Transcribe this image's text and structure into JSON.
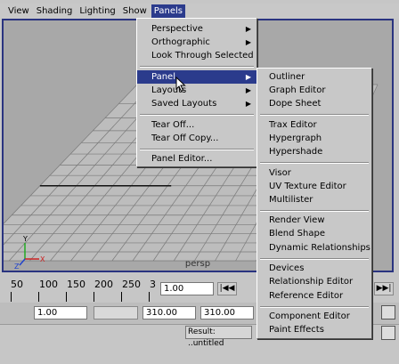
{
  "menubar": {
    "items": [
      {
        "label": "View"
      },
      {
        "label": "Shading"
      },
      {
        "label": "Lighting"
      },
      {
        "label": "Show"
      },
      {
        "label": "Panels"
      }
    ]
  },
  "viewport": {
    "camera_name": "persp",
    "axis": {
      "x": "X",
      "y": "Y",
      "z": "Z"
    }
  },
  "panels_menu": {
    "items": [
      "Perspective",
      "Orthographic",
      "Look Through Selected",
      "Panel",
      "Layouts",
      "Saved Layouts",
      "Tear Off...",
      "Tear Off Copy...",
      "Panel Editor..."
    ]
  },
  "panel_submenu": {
    "items": [
      "Outliner",
      "Graph Editor",
      "Dope Sheet",
      "Trax Editor",
      "Hypergraph",
      "Hypershade",
      "Visor",
      "UV Texture Editor",
      "Multilister",
      "Render View",
      "Blend Shape",
      "Dynamic Relationships",
      "Devices",
      "Relationship Editor",
      "Reference Editor",
      "Component Editor",
      "Paint Effects"
    ]
  },
  "timeline": {
    "ticks": [
      "50",
      "100",
      "150",
      "200",
      "250",
      "3"
    ],
    "current_frame": "1.00",
    "first_btn": "|◀◀",
    "last_btn": "▶▶|"
  },
  "range": {
    "start": "1.00",
    "playback_start": "1.00",
    "playback_end": "310.00",
    "end": "310.00"
  },
  "command": {
    "result_text": "Result: ..untitled"
  },
  "colors": {
    "highlight": "#2b3b8c",
    "viewport_border": "#2a3480",
    "axis_x": "#cc2222",
    "axis_y": "#22aa22",
    "axis_z": "#2244cc"
  }
}
